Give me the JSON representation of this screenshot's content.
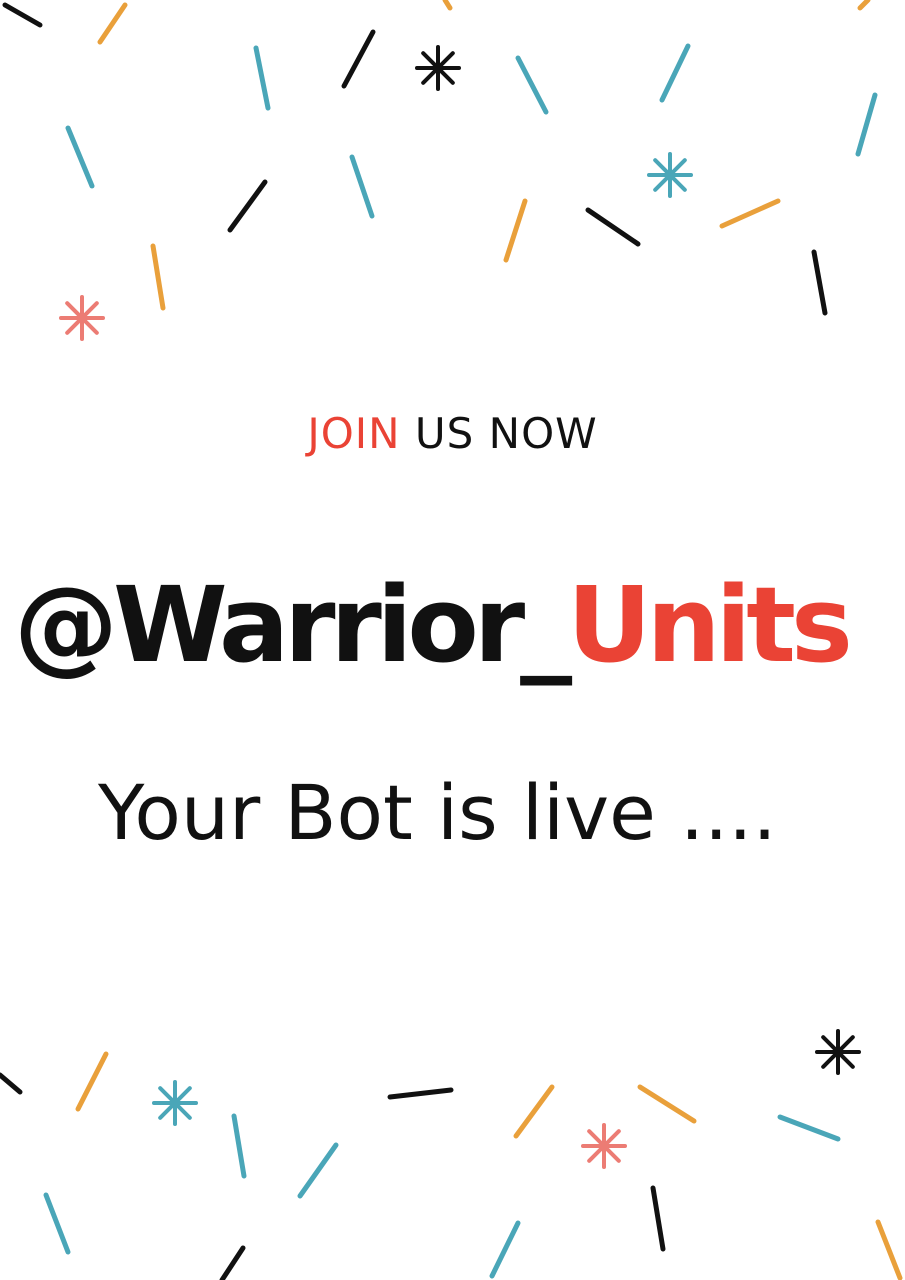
{
  "colors": {
    "background": "#ffffff",
    "accent_red": "#ea4335",
    "text_dark": "#111111",
    "confetti_black": "#111111",
    "confetti_teal": "#4aa6b8",
    "confetti_orange": "#e9a03b",
    "confetti_pink": "#ec7c74"
  },
  "tagline": {
    "highlight": "JOIN",
    "rest": "US NOW"
  },
  "handle": {
    "main": "@Warrior_",
    "highlight": "Units"
  },
  "status_text": "Your Bot is live ....",
  "decorations": {
    "icons": [
      "sparkle-star-icon",
      "confetti-dash-icon"
    ]
  }
}
